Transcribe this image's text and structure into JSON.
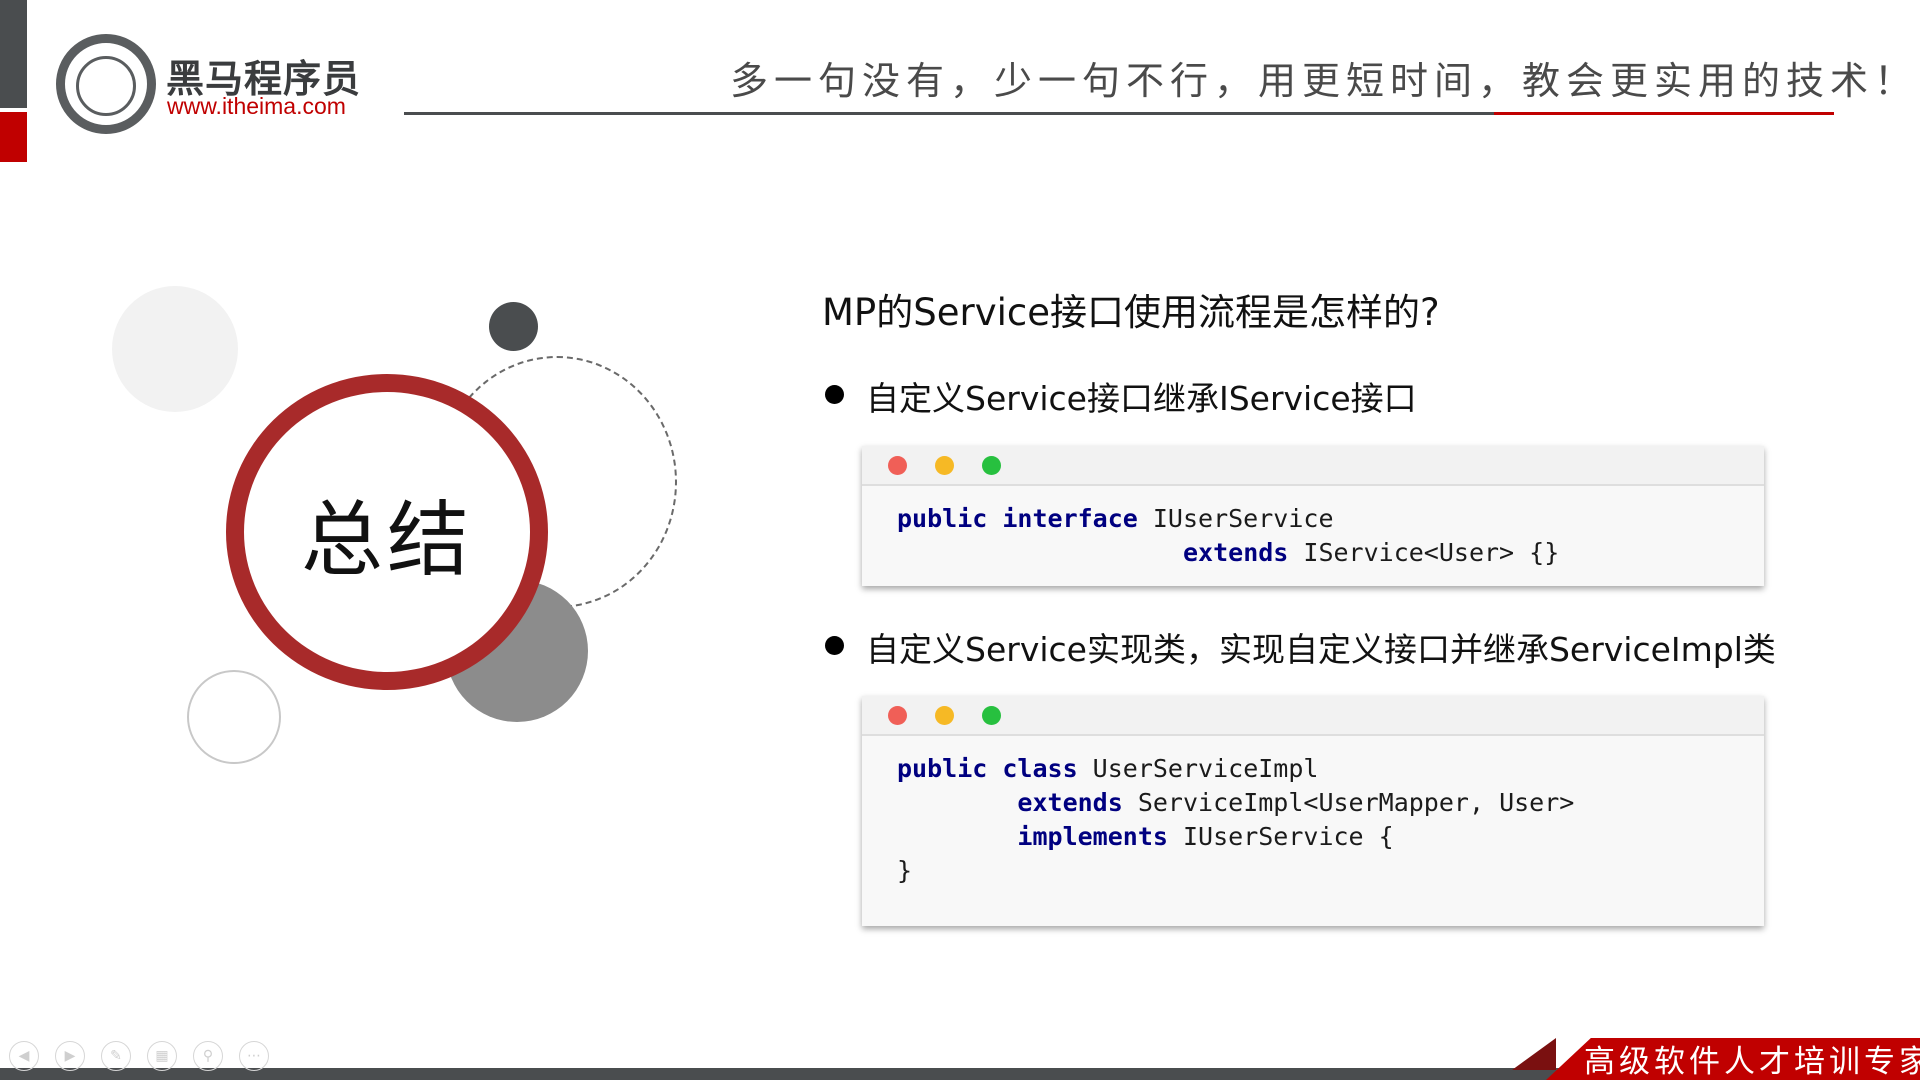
{
  "header": {
    "brand_name": "黑马程序员",
    "brand_url": "www.itheima.com",
    "slogan": "多一句没有，少一句不行，用更短时间，教会更实用的技术！"
  },
  "summary_badge": {
    "label": "总结"
  },
  "content": {
    "question": "MP的Service接口使用流程是怎样的?",
    "points": [
      {
        "text": "自定义Service接口继承IService接口",
        "code_lines": [
          [
            {
              "t": "public interface",
              "kw": true
            },
            {
              "t": " IUserService",
              "kw": false
            }
          ],
          [
            {
              "t": "                   ",
              "kw": false
            },
            {
              "t": "extends",
              "kw": true
            },
            {
              "t": " IService<User> {}",
              "kw": false
            }
          ]
        ]
      },
      {
        "text": "自定义Service实现类，实现自定义接口并继承ServiceImpl类",
        "code_lines": [
          [
            {
              "t": "public class",
              "kw": true
            },
            {
              "t": " UserServiceImpl",
              "kw": false
            }
          ],
          [
            {
              "t": "        ",
              "kw": false
            },
            {
              "t": "extends",
              "kw": true
            },
            {
              "t": " ServiceImpl<UserMapper, User>",
              "kw": false
            }
          ],
          [
            {
              "t": "        ",
              "kw": false
            },
            {
              "t": "implements",
              "kw": true
            },
            {
              "t": " IUserService {",
              "kw": false
            }
          ],
          [
            {
              "t": "}",
              "kw": false
            }
          ]
        ]
      }
    ]
  },
  "footer": {
    "tagline": "高级软件人才培训专家"
  },
  "nav_icons": [
    "prev-icon",
    "next-icon",
    "pen-icon",
    "slides-icon",
    "zoom-icon",
    "more-icon"
  ],
  "colors": {
    "brand_red": "#c00000",
    "dark_gray": "#4a4d4f",
    "badge_ring": "#a82a2a",
    "keyword": "#000080"
  }
}
